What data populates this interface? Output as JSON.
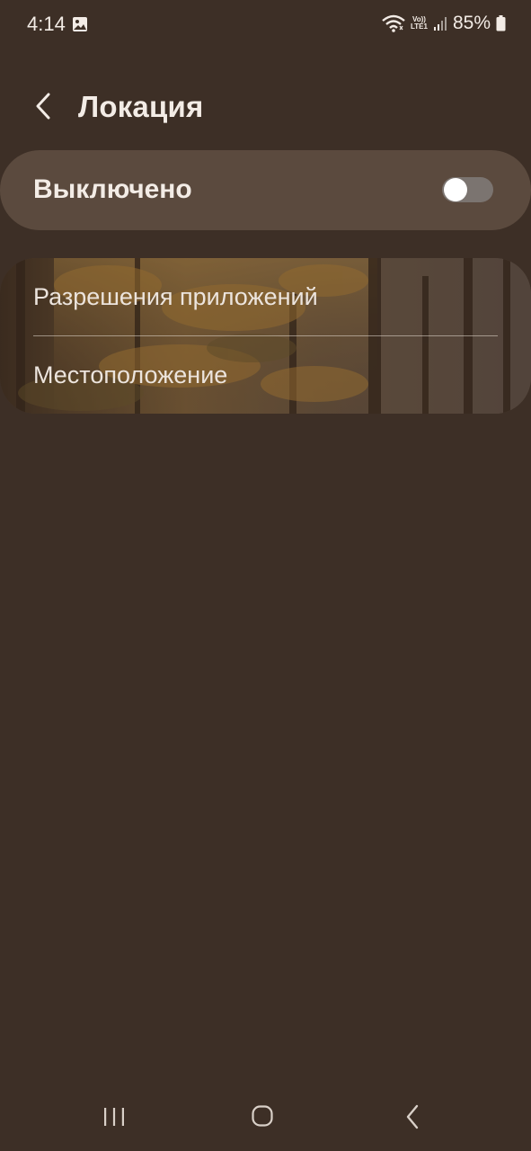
{
  "status_bar": {
    "time": "4:14",
    "battery_percent": "85%",
    "network_tag_top": "Vo))",
    "network_tag_bottom": "LTE1"
  },
  "header": {
    "title": "Локация"
  },
  "master_toggle": {
    "label": "Выключено",
    "state": "off"
  },
  "options": [
    {
      "label": "Разрешения приложений"
    },
    {
      "label": "Местоположение"
    }
  ],
  "nav_bar": {
    "buttons": [
      "recents",
      "home",
      "back"
    ]
  },
  "colors": {
    "background": "#3d2f26",
    "card": "#5b4a3e",
    "text": "#f3ece6",
    "toggle_track_off": "#7b7470"
  }
}
